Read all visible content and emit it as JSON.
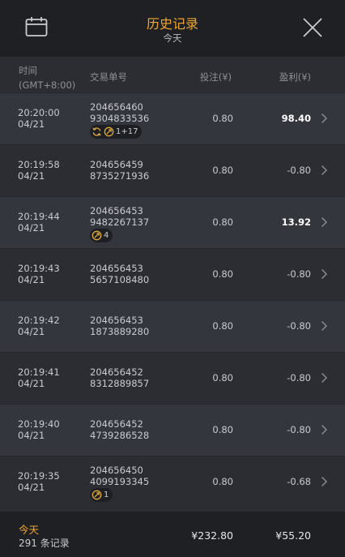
{
  "header": {
    "title": "历史记录",
    "subtitle": "今天",
    "calendar_icon": "calendar-icon",
    "close_icon": "close-icon"
  },
  "columns": {
    "time_line1": "时间",
    "time_line2": "(GMT+8:00)",
    "order": "交易单号",
    "bet": "投注(¥)",
    "profit": "盈利(¥)"
  },
  "rows": [
    {
      "time": "20:20:00",
      "date": "04/21",
      "order1": "204656460",
      "order2": "9304833536",
      "bet": "0.80",
      "profit": "98.40",
      "positive": true,
      "badge": {
        "icons": [
          "refresh-icon",
          "bet-icon"
        ],
        "text": "1+17"
      }
    },
    {
      "time": "20:19:58",
      "date": "04/21",
      "order1": "204656459",
      "order2": "8735271936",
      "bet": "0.80",
      "profit": "-0.80",
      "positive": false,
      "badge": null
    },
    {
      "time": "20:19:44",
      "date": "04/21",
      "order1": "204656453",
      "order2": "9482267137",
      "bet": "0.80",
      "profit": "13.92",
      "positive": true,
      "badge": {
        "icons": [
          "bet-icon"
        ],
        "text": "4"
      }
    },
    {
      "time": "20:19:43",
      "date": "04/21",
      "order1": "204656453",
      "order2": "5657108480",
      "bet": "0.80",
      "profit": "-0.80",
      "positive": false,
      "badge": null
    },
    {
      "time": "20:19:42",
      "date": "04/21",
      "order1": "204656453",
      "order2": "1873889280",
      "bet": "0.80",
      "profit": "-0.80",
      "positive": false,
      "badge": null
    },
    {
      "time": "20:19:41",
      "date": "04/21",
      "order1": "204656452",
      "order2": "8312889857",
      "bet": "0.80",
      "profit": "-0.80",
      "positive": false,
      "badge": null
    },
    {
      "time": "20:19:40",
      "date": "04/21",
      "order1": "204656452",
      "order2": "4739286528",
      "bet": "0.80",
      "profit": "-0.80",
      "positive": false,
      "badge": null
    },
    {
      "time": "20:19:35",
      "date": "04/21",
      "order1": "204656450",
      "order2": "4099193345",
      "bet": "0.80",
      "profit": "-0.68",
      "positive": false,
      "badge": {
        "icons": [
          "bet-icon"
        ],
        "text": "1"
      }
    }
  ],
  "footer": {
    "label": "今天",
    "count": "291 条记录",
    "total_bet": "¥232.80",
    "total_profit": "¥55.20"
  },
  "colors": {
    "accent": "#f0a532",
    "badge_icon": "#e0a93a",
    "background": "#2b2d33",
    "header": "#1f2024"
  }
}
